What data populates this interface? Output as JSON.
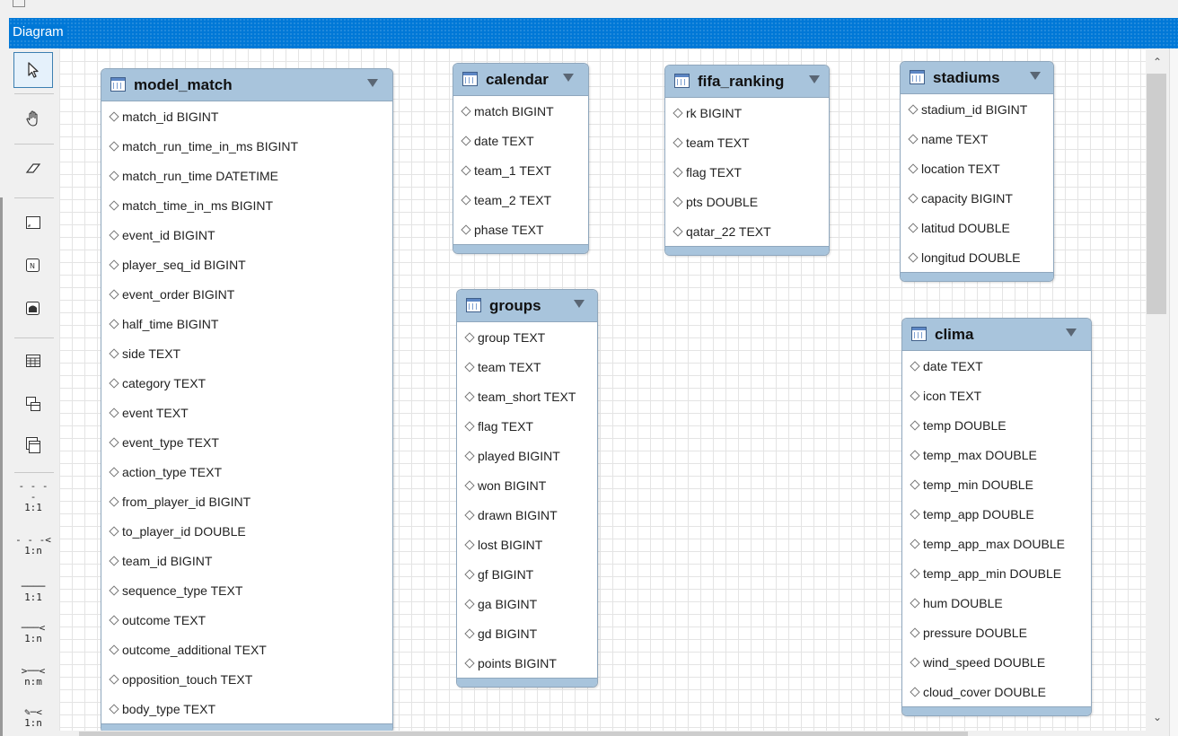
{
  "panel": {
    "title": "Diagram"
  },
  "toolbar": {
    "rel_1_1_nonid": "1:1",
    "rel_1_n_nonid": "1:n",
    "rel_1_1_id": "1:1",
    "rel_1_n_id": "1:n",
    "rel_n_m": "n:m",
    "rel_1_n_existing": "1:n"
  },
  "tables": {
    "model_match": {
      "name": "model_match",
      "columns": [
        "match_id BIGINT",
        "match_run_time_in_ms BIGINT",
        "match_run_time DATETIME",
        "match_time_in_ms BIGINT",
        "event_id BIGINT",
        "player_seq_id BIGINT",
        "event_order BIGINT",
        "half_time BIGINT",
        "side TEXT",
        "category TEXT",
        "event TEXT",
        "event_type TEXT",
        "action_type TEXT",
        "from_player_id BIGINT",
        "to_player_id DOUBLE",
        "team_id BIGINT",
        "sequence_type TEXT",
        "outcome TEXT",
        "outcome_additional TEXT",
        "opposition_touch TEXT",
        "body_type TEXT"
      ]
    },
    "calendar": {
      "name": "calendar",
      "columns": [
        "match BIGINT",
        "date TEXT",
        "team_1 TEXT",
        "team_2 TEXT",
        "phase TEXT"
      ]
    },
    "fifa_ranking": {
      "name": "fifa_ranking",
      "columns": [
        "rk BIGINT",
        "team TEXT",
        "flag TEXT",
        "pts DOUBLE",
        "qatar_22 TEXT"
      ]
    },
    "stadiums": {
      "name": "stadiums",
      "columns": [
        "stadium_id BIGINT",
        "name TEXT",
        "location TEXT",
        "capacity BIGINT",
        "latitud DOUBLE",
        "longitud DOUBLE"
      ]
    },
    "groups": {
      "name": "groups",
      "columns": [
        "group TEXT",
        "team TEXT",
        "team_short TEXT",
        "flag TEXT",
        "played BIGINT",
        "won BIGINT",
        "drawn BIGINT",
        "lost BIGINT",
        "gf BIGINT",
        "ga BIGINT",
        "gd BIGINT",
        "points BIGINT"
      ]
    },
    "clima": {
      "name": "clima",
      "columns": [
        "date TEXT",
        "icon TEXT",
        "temp DOUBLE",
        "temp_max DOUBLE",
        "temp_min DOUBLE",
        "temp_app DOUBLE",
        "temp_app_max DOUBLE",
        "temp_app_min DOUBLE",
        "hum DOUBLE",
        "pressure DOUBLE",
        "wind_speed DOUBLE",
        "cloud_cover DOUBLE"
      ]
    }
  }
}
